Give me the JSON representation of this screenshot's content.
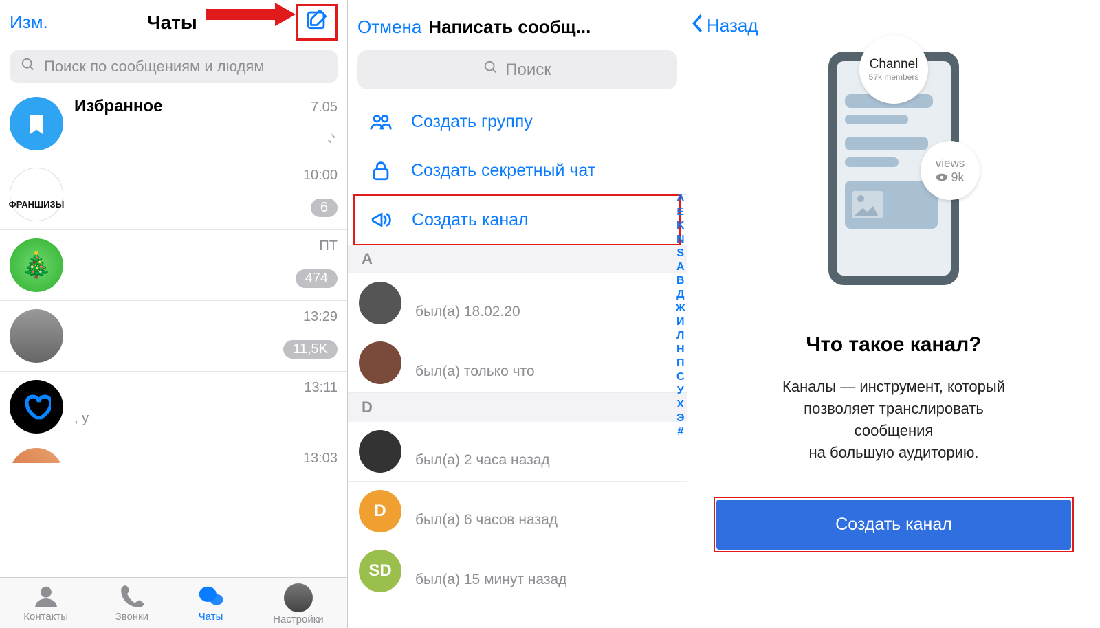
{
  "panel1": {
    "edit_label": "Изм.",
    "title": "Чаты",
    "search_placeholder": "Поиск по сообщениям и людям",
    "chats": [
      {
        "name": "Избранное",
        "time": "7.05",
        "sub": "",
        "badge": "",
        "pinned": true,
        "avatar": "saved"
      },
      {
        "name": "",
        "time": "10:00",
        "sub": "",
        "badge": "6",
        "avatar": "fr",
        "avatar_text": "ФРАНШИЗЫ"
      },
      {
        "name": "",
        "time": "ПТ",
        "sub": "",
        "badge": "474",
        "avatar": "tree"
      },
      {
        "name": "",
        "time": "13:29",
        "sub": "",
        "badge": "11,5K",
        "avatar": "wardrobe"
      },
      {
        "name": "",
        "time": "13:11",
        "sub": ", у",
        "badge": "",
        "avatar": "heart"
      },
      {
        "name": "",
        "time": "13:03",
        "sub": "",
        "badge": "",
        "avatar": "partial"
      }
    ],
    "tabs": {
      "contacts": "Контакты",
      "calls": "Звонки",
      "chats": "Чаты",
      "settings": "Настройки"
    }
  },
  "panel2": {
    "cancel": "Отмена",
    "title": "Написать сообщ...",
    "search_placeholder": "Поиск",
    "actions": {
      "group": "Создать группу",
      "secret": "Создать секретный чат",
      "channel": "Создать канал"
    },
    "sections": [
      {
        "letter": "A",
        "contacts": [
          {
            "status": "был(а) 18.02.20",
            "color": "#555"
          },
          {
            "status": "был(а) только что",
            "color": "#7a4b3b"
          }
        ]
      },
      {
        "letter": "D",
        "contacts": [
          {
            "status": "был(а) 2 часа назад",
            "color": "#333"
          },
          {
            "status": "был(а) 6 часов назад",
            "color": "#f0a030",
            "initial": "D"
          },
          {
            "status": "был(а) 15 минут назад",
            "color": "#9bbf4d",
            "initial": "SD"
          }
        ]
      }
    ],
    "index": [
      "А",
      "E",
      "K",
      "N",
      "S",
      "А",
      "В",
      "Д",
      "Ж",
      "И",
      "Л",
      "Н",
      "П",
      "С",
      "У",
      "Х",
      "Э",
      "#"
    ]
  },
  "panel3": {
    "back": "Назад",
    "illus": {
      "channel_title": "Channel",
      "channel_sub": "57k members",
      "views_label": "views",
      "views_count": "9k"
    },
    "heading": "Что такое канал?",
    "desc_l1": "Каналы — инструмент, который",
    "desc_l2": "позволяет транслировать",
    "desc_l3": "сообщения",
    "desc_l4": "на большую аудиторию.",
    "button": "Создать канал"
  }
}
